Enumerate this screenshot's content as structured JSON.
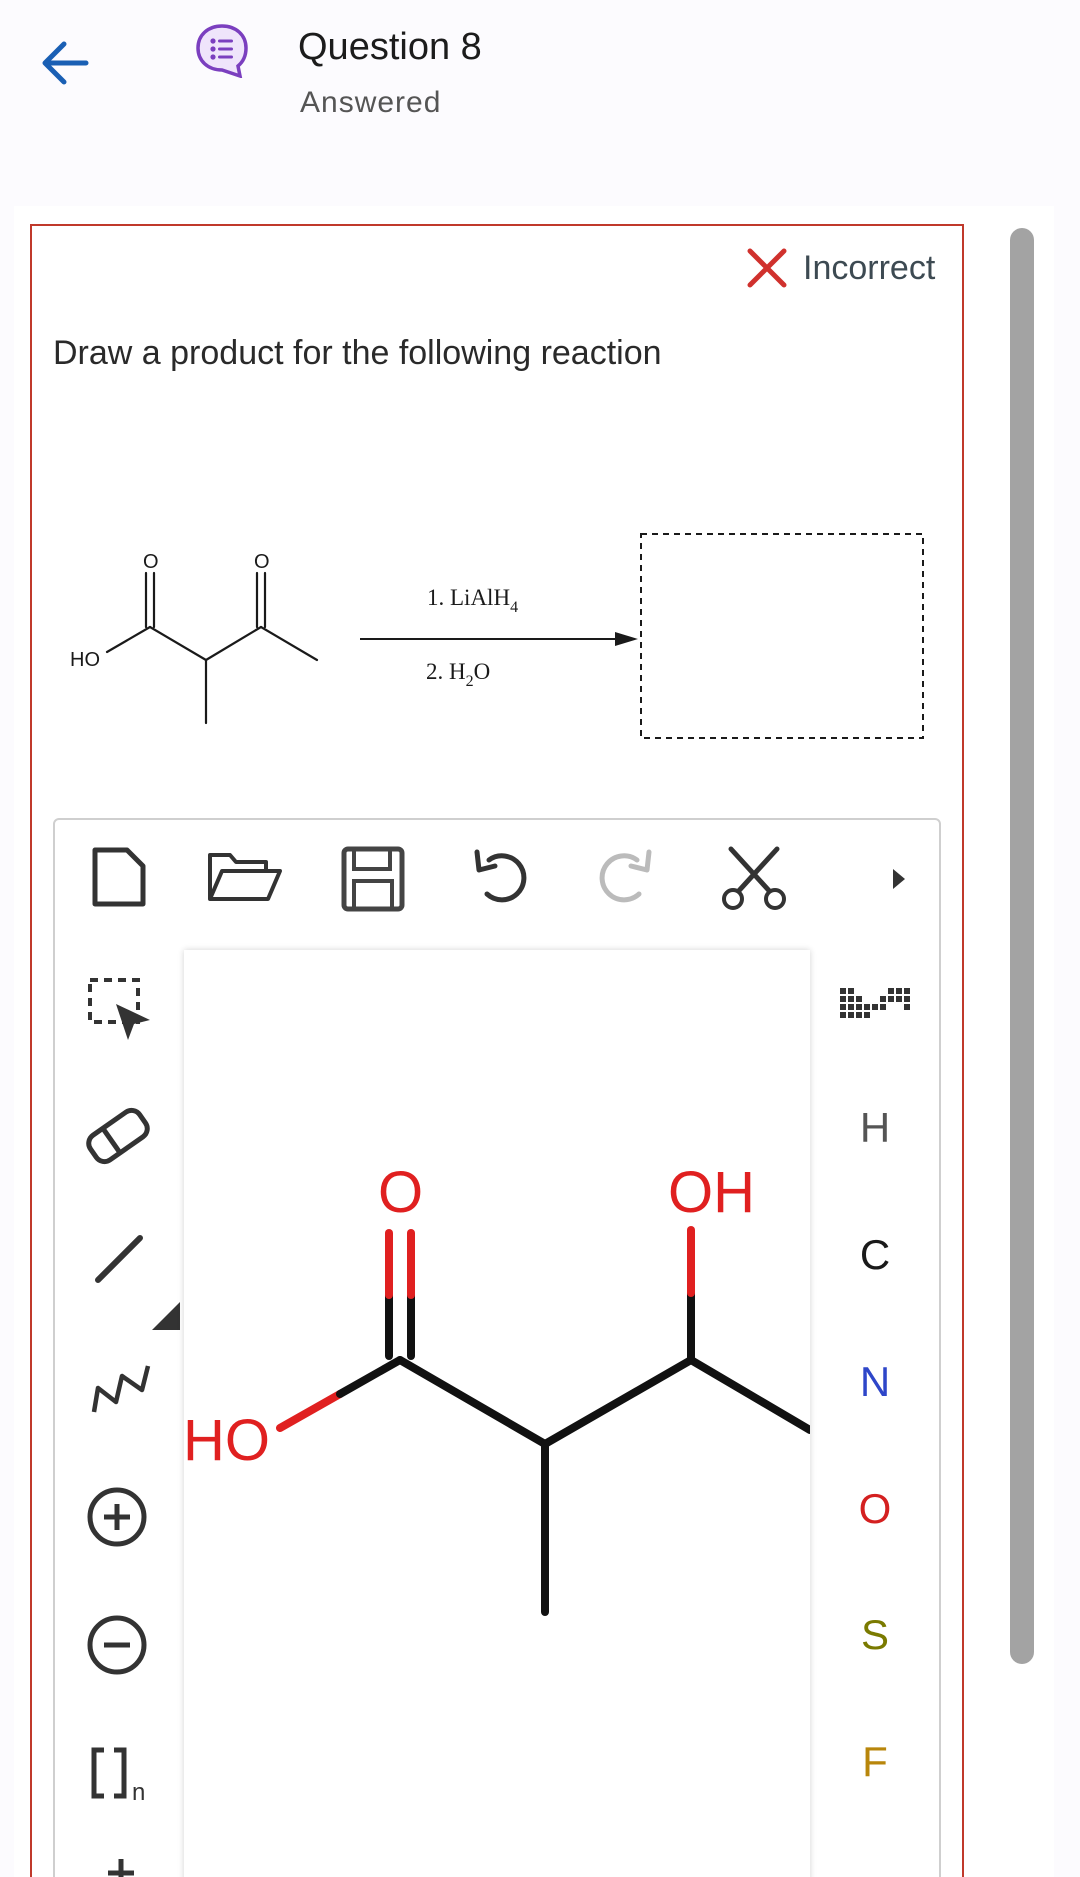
{
  "header": {
    "title": "Question 8",
    "subtitle": "Answered"
  },
  "status": {
    "label": "Incorrect",
    "color": "#d0312d"
  },
  "question": {
    "prompt": "Draw a product for the following reaction"
  },
  "reaction": {
    "reactant_labels": {
      "hydroxyl": "HO",
      "oxygen1": "O",
      "oxygen2": "O"
    },
    "reagent1_prefix": "1. LiAlH",
    "reagent1_sub": "4",
    "reagent2_prefix": "2. H",
    "reagent2_sub": "2",
    "reagent2_suffix": "O"
  },
  "toolbar": {
    "icons": [
      "new-file-icon",
      "open-folder-icon",
      "save-icon",
      "undo-icon",
      "redo-icon",
      "cut-icon",
      "more-icon"
    ]
  },
  "left_tools": {
    "bracket_sub": "n"
  },
  "elements": [
    {
      "symbol": "H",
      "color": "#555555"
    },
    {
      "symbol": "C",
      "color": "#1a1a1a"
    },
    {
      "symbol": "N",
      "color": "#2e46c9"
    },
    {
      "symbol": "O",
      "color": "#d42020"
    },
    {
      "symbol": "S",
      "color": "#7a7a00"
    },
    {
      "symbol": "F",
      "color": "#b8860b"
    }
  ],
  "drawing": {
    "ho_label": "HO",
    "o_label": "O",
    "oh_label": "OH"
  }
}
